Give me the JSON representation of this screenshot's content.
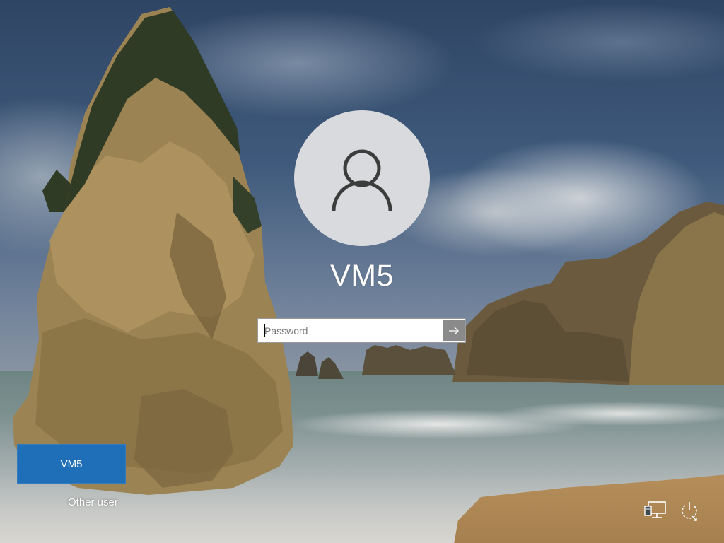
{
  "lock_screen": {
    "account_name": "VM5",
    "password_field": {
      "value": "",
      "placeholder": "Password"
    },
    "submit_icon": "arrow-right-icon"
  },
  "user_switcher": {
    "tiles": [
      {
        "label": "VM5",
        "selected": true
      }
    ],
    "other_user_label": "Other user"
  },
  "system_tray": {
    "network_icon": "network-icon",
    "power_icon": "power-icon"
  },
  "colors": {
    "selected_tile": "#1f6fb8",
    "avatar_bg": "#d9dadd",
    "avatar_glyph": "#3c3c3c",
    "submit_bg": "#8a8a8a"
  }
}
